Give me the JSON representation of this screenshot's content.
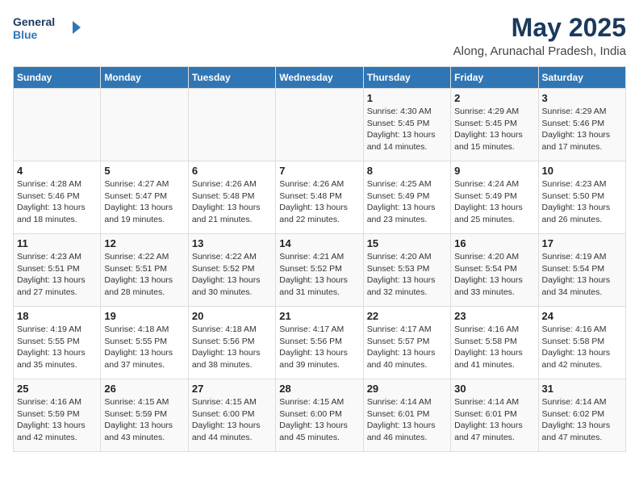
{
  "logo": {
    "line1": "General",
    "line2": "Blue"
  },
  "title": "May 2025",
  "subtitle": "Along, Arunachal Pradesh, India",
  "weekdays": [
    "Sunday",
    "Monday",
    "Tuesday",
    "Wednesday",
    "Thursday",
    "Friday",
    "Saturday"
  ],
  "weeks": [
    [
      {
        "day": "",
        "detail": ""
      },
      {
        "day": "",
        "detail": ""
      },
      {
        "day": "",
        "detail": ""
      },
      {
        "day": "",
        "detail": ""
      },
      {
        "day": "1",
        "detail": "Sunrise: 4:30 AM\nSunset: 5:45 PM\nDaylight: 13 hours\nand 14 minutes."
      },
      {
        "day": "2",
        "detail": "Sunrise: 4:29 AM\nSunset: 5:45 PM\nDaylight: 13 hours\nand 15 minutes."
      },
      {
        "day": "3",
        "detail": "Sunrise: 4:29 AM\nSunset: 5:46 PM\nDaylight: 13 hours\nand 17 minutes."
      }
    ],
    [
      {
        "day": "4",
        "detail": "Sunrise: 4:28 AM\nSunset: 5:46 PM\nDaylight: 13 hours\nand 18 minutes."
      },
      {
        "day": "5",
        "detail": "Sunrise: 4:27 AM\nSunset: 5:47 PM\nDaylight: 13 hours\nand 19 minutes."
      },
      {
        "day": "6",
        "detail": "Sunrise: 4:26 AM\nSunset: 5:48 PM\nDaylight: 13 hours\nand 21 minutes."
      },
      {
        "day": "7",
        "detail": "Sunrise: 4:26 AM\nSunset: 5:48 PM\nDaylight: 13 hours\nand 22 minutes."
      },
      {
        "day": "8",
        "detail": "Sunrise: 4:25 AM\nSunset: 5:49 PM\nDaylight: 13 hours\nand 23 minutes."
      },
      {
        "day": "9",
        "detail": "Sunrise: 4:24 AM\nSunset: 5:49 PM\nDaylight: 13 hours\nand 25 minutes."
      },
      {
        "day": "10",
        "detail": "Sunrise: 4:23 AM\nSunset: 5:50 PM\nDaylight: 13 hours\nand 26 minutes."
      }
    ],
    [
      {
        "day": "11",
        "detail": "Sunrise: 4:23 AM\nSunset: 5:51 PM\nDaylight: 13 hours\nand 27 minutes."
      },
      {
        "day": "12",
        "detail": "Sunrise: 4:22 AM\nSunset: 5:51 PM\nDaylight: 13 hours\nand 28 minutes."
      },
      {
        "day": "13",
        "detail": "Sunrise: 4:22 AM\nSunset: 5:52 PM\nDaylight: 13 hours\nand 30 minutes."
      },
      {
        "day": "14",
        "detail": "Sunrise: 4:21 AM\nSunset: 5:52 PM\nDaylight: 13 hours\nand 31 minutes."
      },
      {
        "day": "15",
        "detail": "Sunrise: 4:20 AM\nSunset: 5:53 PM\nDaylight: 13 hours\nand 32 minutes."
      },
      {
        "day": "16",
        "detail": "Sunrise: 4:20 AM\nSunset: 5:54 PM\nDaylight: 13 hours\nand 33 minutes."
      },
      {
        "day": "17",
        "detail": "Sunrise: 4:19 AM\nSunset: 5:54 PM\nDaylight: 13 hours\nand 34 minutes."
      }
    ],
    [
      {
        "day": "18",
        "detail": "Sunrise: 4:19 AM\nSunset: 5:55 PM\nDaylight: 13 hours\nand 35 minutes."
      },
      {
        "day": "19",
        "detail": "Sunrise: 4:18 AM\nSunset: 5:55 PM\nDaylight: 13 hours\nand 37 minutes."
      },
      {
        "day": "20",
        "detail": "Sunrise: 4:18 AM\nSunset: 5:56 PM\nDaylight: 13 hours\nand 38 minutes."
      },
      {
        "day": "21",
        "detail": "Sunrise: 4:17 AM\nSunset: 5:56 PM\nDaylight: 13 hours\nand 39 minutes."
      },
      {
        "day": "22",
        "detail": "Sunrise: 4:17 AM\nSunset: 5:57 PM\nDaylight: 13 hours\nand 40 minutes."
      },
      {
        "day": "23",
        "detail": "Sunrise: 4:16 AM\nSunset: 5:58 PM\nDaylight: 13 hours\nand 41 minutes."
      },
      {
        "day": "24",
        "detail": "Sunrise: 4:16 AM\nSunset: 5:58 PM\nDaylight: 13 hours\nand 42 minutes."
      }
    ],
    [
      {
        "day": "25",
        "detail": "Sunrise: 4:16 AM\nSunset: 5:59 PM\nDaylight: 13 hours\nand 42 minutes."
      },
      {
        "day": "26",
        "detail": "Sunrise: 4:15 AM\nSunset: 5:59 PM\nDaylight: 13 hours\nand 43 minutes."
      },
      {
        "day": "27",
        "detail": "Sunrise: 4:15 AM\nSunset: 6:00 PM\nDaylight: 13 hours\nand 44 minutes."
      },
      {
        "day": "28",
        "detail": "Sunrise: 4:15 AM\nSunset: 6:00 PM\nDaylight: 13 hours\nand 45 minutes."
      },
      {
        "day": "29",
        "detail": "Sunrise: 4:14 AM\nSunset: 6:01 PM\nDaylight: 13 hours\nand 46 minutes."
      },
      {
        "day": "30",
        "detail": "Sunrise: 4:14 AM\nSunset: 6:01 PM\nDaylight: 13 hours\nand 47 minutes."
      },
      {
        "day": "31",
        "detail": "Sunrise: 4:14 AM\nSunset: 6:02 PM\nDaylight: 13 hours\nand 47 minutes."
      }
    ]
  ]
}
